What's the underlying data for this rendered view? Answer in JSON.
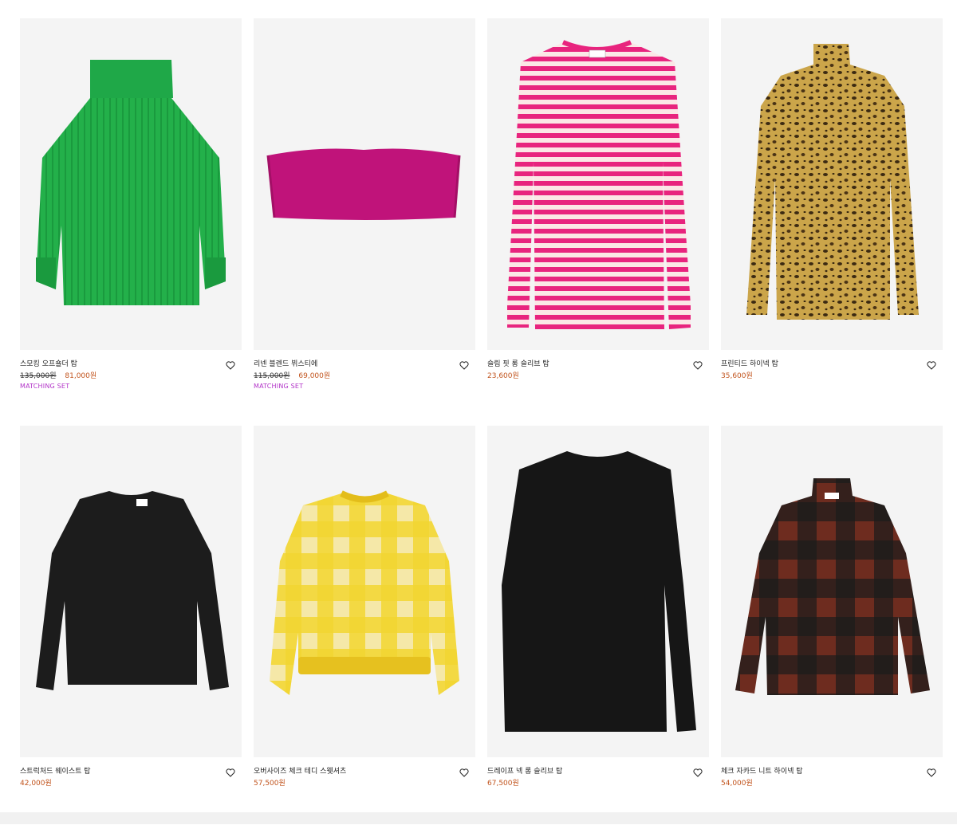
{
  "products": [
    {
      "name": "스모킹 오프숄더 탑",
      "old_price": "135,000원",
      "price": "81,000원",
      "tag": "MATCHING SET",
      "image": "green-smocked-off-shoulder-top",
      "color": "#22b14c"
    },
    {
      "name": "리넨 블렌드 뷔스티에",
      "old_price": "115,000원",
      "price": "69,000원",
      "tag": "MATCHING SET",
      "image": "magenta-bustier",
      "color": "#c0137a"
    },
    {
      "name": "슬림 핏 롱 슬리브 탑",
      "old_price": "",
      "price": "23,600원",
      "tag": "",
      "image": "pink-striped-long-sleeve",
      "color": "#e8247e"
    },
    {
      "name": "프린티드 하이넥 탑",
      "old_price": "",
      "price": "35,600원",
      "tag": "",
      "image": "leopard-print-turtleneck",
      "color": "#c8a542"
    },
    {
      "name": "스트럭처드 웨이스트 탑",
      "old_price": "",
      "price": "42,000원",
      "tag": "",
      "image": "black-structured-top",
      "color": "#1c1c1c"
    },
    {
      "name": "오버사이즈 체크 테디 스웻셔츠",
      "old_price": "",
      "price": "57,500원",
      "tag": "",
      "image": "yellow-check-teddy-sweatshirt",
      "color": "#f1d21e"
    },
    {
      "name": "드레이프 넥 롱 슬리브 탑",
      "old_price": "",
      "price": "67,500원",
      "tag": "",
      "image": "black-drape-neck-top",
      "color": "#161616"
    },
    {
      "name": "체크 자카드 니트 하이넥 탑",
      "old_price": "",
      "price": "54,000원",
      "tag": "",
      "image": "brown-check-jacquard-turtleneck",
      "color": "#6b2a1c"
    }
  ],
  "icons": {
    "wishlist": "heart-outline-icon"
  },
  "colors": {
    "price": "#c1531c",
    "tag": "#b233c8",
    "image_bg": "#f4f4f4"
  }
}
